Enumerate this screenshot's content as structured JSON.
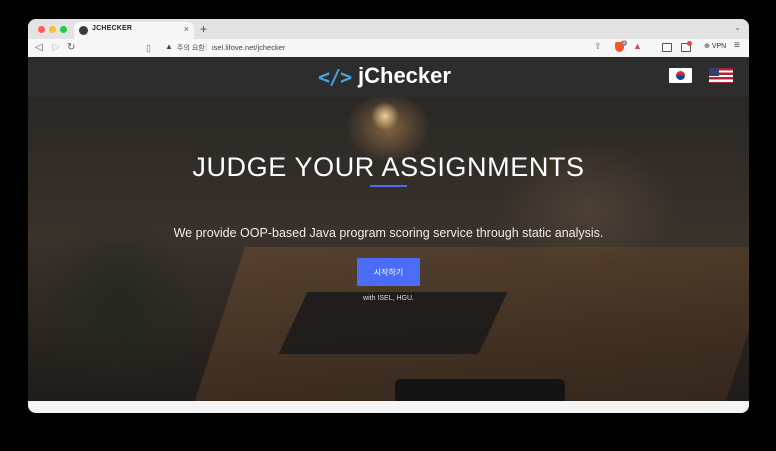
{
  "browser": {
    "tab_title": "JCHECKER",
    "tab_close": "×",
    "new_tab": "+",
    "tab_menu": "⌄",
    "security_warning": "주의 요함",
    "url": "isel.lifove.net/jchecker",
    "vpn_label": "VPN",
    "brave_badge_count": "1",
    "icons": {
      "back": "back-arrow-icon",
      "forward": "forward-arrow-icon",
      "reload": "reload-icon",
      "bookmark": "bookmark-icon",
      "warning": "warning-icon",
      "share": "share-icon",
      "shields": "brave-shields-icon",
      "rewards": "rewards-icon",
      "sidebar": "sidebar-icon",
      "wallet": "wallet-icon",
      "menu": "menu-icon"
    }
  },
  "site": {
    "logo_mark": "</>",
    "logo_text": "jChecker",
    "languages": [
      {
        "name": "korean-flag",
        "colors": [
          "#ffffff",
          "#cd2e3a",
          "#0047a0"
        ]
      },
      {
        "name": "us-flag",
        "colors": [
          "#b22234",
          "#ffffff",
          "#3c3b6e"
        ]
      }
    ]
  },
  "hero": {
    "title": "JUDGE YOUR ASSIGNMENTS",
    "subtitle": "We provide OOP-based Java program scoring service through static analysis.",
    "start_button": "시작하기",
    "credit": "with ISEL, HGU."
  },
  "colors": {
    "accent": "#4a6cf7",
    "nav_bg": "#2d2d2d",
    "logo_mark": "#4aa3e0"
  }
}
